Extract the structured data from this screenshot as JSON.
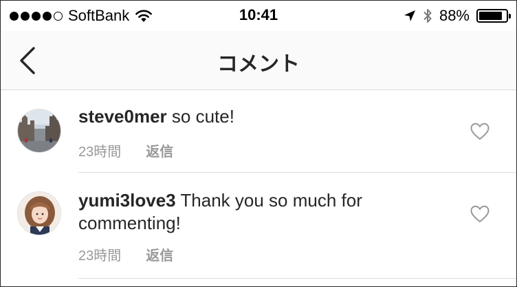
{
  "status_bar": {
    "carrier": "SoftBank",
    "time": "10:41",
    "battery_percent": "88%",
    "battery_level": 0.88,
    "signal_dots_filled": 4,
    "signal_dots_total": 5
  },
  "nav": {
    "title": "コメント"
  },
  "comments": [
    {
      "username": "steve0mer",
      "text": " so cute!",
      "time": "23時間",
      "reply_label": "返信"
    },
    {
      "username": "yumi3love3",
      "text": " Thank you so much for commenting!",
      "time": "23時間",
      "reply_label": "返信"
    }
  ],
  "colors": {
    "text": "#262626",
    "meta": "#999999",
    "divider": "#dbdbdb",
    "nav_bg": "#fafafa"
  }
}
